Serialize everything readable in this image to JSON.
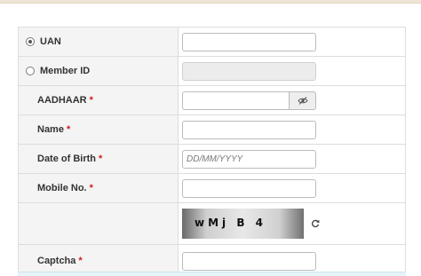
{
  "form": {
    "uan_label": "UAN",
    "uan_value": "",
    "member_id_label": "Member ID",
    "member_id_value": "",
    "aadhaar_label": "AADHAAR",
    "aadhaar_value": "",
    "name_label": "Name",
    "name_value": "",
    "dob_label": "Date of Birth",
    "dob_placeholder": "DD/MM/YYYY",
    "mobile_label": "Mobile No.",
    "mobile_value": "",
    "captcha_image_text": "wMj B 4",
    "captcha_label": "Captcha",
    "captcha_value": "",
    "required_mark": "*",
    "selected_option": "UAN"
  },
  "icons": {
    "eye": "eye-slash-icon",
    "refresh": "refresh-icon"
  },
  "colors": {
    "required": "#d0201b",
    "label_bg": "#f4f4f4",
    "border": "#dddddd"
  }
}
